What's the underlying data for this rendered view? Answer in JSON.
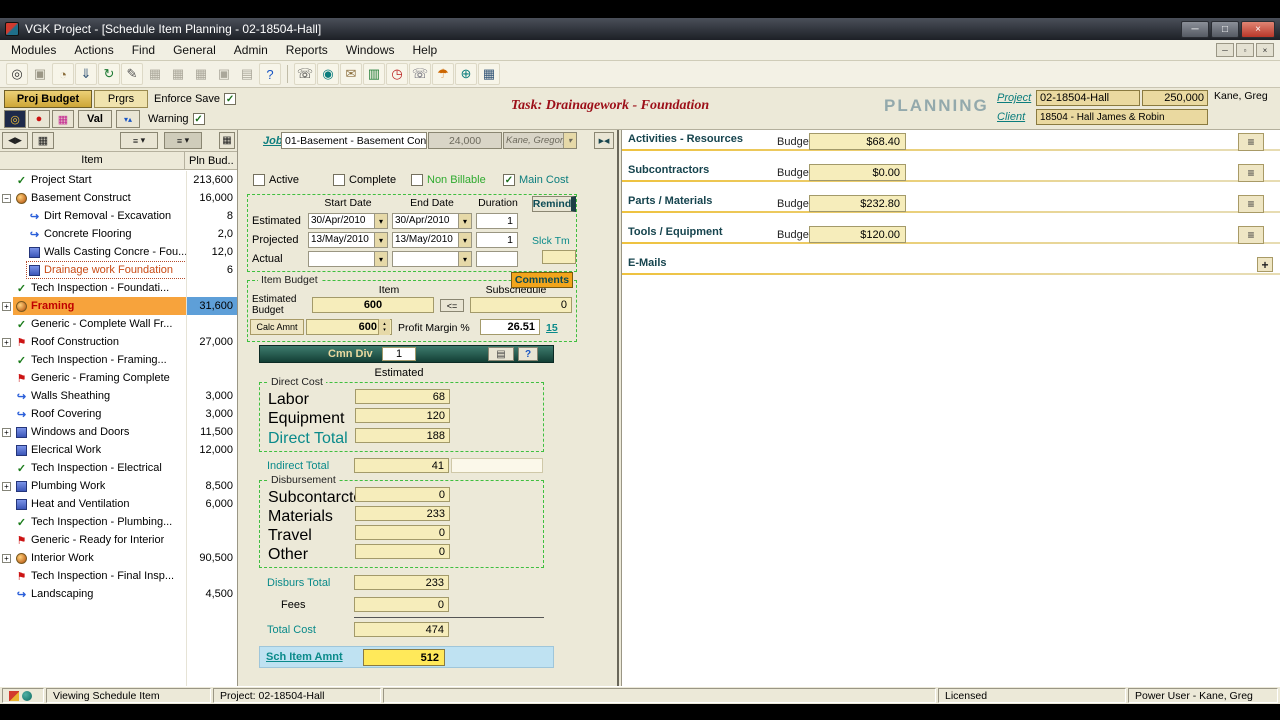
{
  "window": {
    "title": "VGK Project - [Schedule Item Planning - 02-18504-Hall]",
    "menu": [
      "Modules",
      "Actions",
      "Find",
      "General",
      "Admin",
      "Reports",
      "Windows",
      "Help"
    ]
  },
  "icons": {
    "dropdown": "▾",
    "check": "✓",
    "menu_lines": "≡",
    "plus": "+",
    "help": "?",
    "collapse": "▶◀",
    "minimize": "─",
    "maximize": "□",
    "close": "×",
    "mdi_min": "─",
    "mdi_restore": "▫",
    "mdi_close": "×",
    "spin_up": "▴",
    "spin_down": "▾",
    "nav": "◀▶",
    "grid": "▦",
    "printer": "▤",
    "record": "◎",
    "red_dot": "●",
    "magenta_grid": "▦",
    "flags_small": "▾▴"
  },
  "toolbar": {
    "icons": [
      {
        "name": "find-icon",
        "glyph": "◎",
        "color": "#333"
      },
      {
        "name": "save-icon",
        "glyph": "▣",
        "color": "#9a9685",
        "disabled": true
      },
      {
        "name": "schedule-icon",
        "glyph": "◔",
        "color": "#8a6d3b"
      },
      {
        "name": "export-icon",
        "glyph": "⇓",
        "color": "#335577"
      },
      {
        "name": "refresh-icon",
        "glyph": "↻",
        "color": "#1d7a33"
      },
      {
        "name": "edit-icon",
        "glyph": "✎",
        "color": "#555555"
      },
      {
        "name": "media-icon-1",
        "glyph": "▦",
        "color": "#aaa79a",
        "disabled": true
      },
      {
        "name": "media-icon-2",
        "glyph": "▦",
        "color": "#aaa79a",
        "disabled": true
      },
      {
        "name": "media-icon-3",
        "glyph": "▦",
        "color": "#aaa79a",
        "disabled": true
      },
      {
        "name": "copy-icon",
        "glyph": "▣",
        "color": "#aaa79a",
        "disabled": true
      },
      {
        "name": "print-icon",
        "glyph": "▤",
        "color": "#aaa79a",
        "disabled": true
      },
      {
        "name": "help-icon",
        "glyph": "?",
        "color": "#1a56c4"
      },
      {
        "sep": true
      },
      {
        "name": "phone-icon",
        "glyph": "☏",
        "color": "#333333"
      },
      {
        "name": "camera-icon",
        "glyph": "◉",
        "color": "#0b7d7d"
      },
      {
        "name": "mail-icon",
        "glyph": "✉",
        "color": "#8a6d3b"
      },
      {
        "name": "chart-icon",
        "glyph": "▥",
        "color": "#1d7a33"
      },
      {
        "name": "alarm-icon",
        "glyph": "◷",
        "color": "#bb2222"
      },
      {
        "name": "fax-icon",
        "glyph": "☏",
        "color": "#556"
      },
      {
        "name": "vacation-icon",
        "glyph": "☂",
        "color": "#cc6600"
      },
      {
        "name": "globe-icon",
        "glyph": "⊕",
        "color": "#0b7d7d"
      },
      {
        "name": "calendar-icon",
        "glyph": "▦",
        "color": "#335577"
      }
    ]
  },
  "header": {
    "tab_proj_budget": "Proj Budget",
    "tab_prgrs": "Prgrs",
    "enforce_save_label": "Enforce Save",
    "val_label": "Val",
    "warning_label": "Warning",
    "task_title": "Task: Drainagework - Foundation",
    "mode": "PLANNING",
    "project_label": "Project",
    "project_code": "02-18504-Hall",
    "project_budget": "250,000",
    "user_name": "Kane, Greg",
    "client_label": "Client",
    "client_value": "18504 - Hall James & Robin"
  },
  "tree": {
    "col_item": "Item",
    "col_budget": "Pln Bud..",
    "items": [
      {
        "icon": "check",
        "label": "Project Start",
        "value": "213,600",
        "indent": 1
      },
      {
        "icon": "globe",
        "label": "Basement Construct",
        "value": "16,000",
        "indent": 0,
        "expander": "minus"
      },
      {
        "icon": "arrow",
        "label": "Dirt Removal - Excavation",
        "value": "8",
        "indent": 2
      },
      {
        "icon": "arrow",
        "label": "Concrete Flooring",
        "value": "2,0",
        "indent": 2
      },
      {
        "icon": "doc",
        "label": "Walls Casting Concre - Fou...",
        "value": "12,0",
        "indent": 2
      },
      {
        "icon": "doc",
        "label": "Drainage work Foundation",
        "value": "6",
        "indent": 2,
        "state": "active-red"
      },
      {
        "icon": "check",
        "label": "Tech Inspection - Foundati...",
        "value": "",
        "indent": 1
      },
      {
        "icon": "globe",
        "label": "Framing",
        "value": "31,600",
        "indent": 0,
        "expander": "plus",
        "state": "selected"
      },
      {
        "icon": "check",
        "label": "Generic - Complete Wall Fr...",
        "value": "",
        "indent": 1
      },
      {
        "icon": "flag",
        "label": "Roof Construction",
        "value": "27,000",
        "indent": 0,
        "expander": "plus"
      },
      {
        "icon": "check",
        "label": "Tech Inspection - Framing...",
        "value": "",
        "indent": 1
      },
      {
        "icon": "flag",
        "label": "Generic - Framing Complete",
        "value": "",
        "indent": 1
      },
      {
        "icon": "arrow",
        "label": "Walls Sheathing",
        "value": "3,000",
        "indent": 1
      },
      {
        "icon": "arrow",
        "label": "Roof Covering",
        "value": "3,000",
        "indent": 1
      },
      {
        "icon": "doc",
        "label": "Windows and Doors",
        "value": "11,500",
        "indent": 0,
        "expander": "plus"
      },
      {
        "icon": "doc",
        "label": "Elecrical Work",
        "value": "12,000",
        "indent": 1
      },
      {
        "icon": "check",
        "label": "Tech Inspection - Electrical",
        "value": "",
        "indent": 1
      },
      {
        "icon": "doc",
        "label": "Plumbing Work",
        "value": "8,500",
        "indent": 0,
        "expander": "plus"
      },
      {
        "icon": "doc",
        "label": "Heat and Ventilation",
        "value": "6,000",
        "indent": 1
      },
      {
        "icon": "check",
        "label": "Tech Inspection - Plumbing...",
        "value": "",
        "indent": 1
      },
      {
        "icon": "flag",
        "label": "Generic - Ready for Interior",
        "value": "",
        "indent": 1
      },
      {
        "icon": "globe",
        "label": "Interior Work",
        "value": "90,500",
        "indent": 0,
        "expander": "plus"
      },
      {
        "icon": "flag",
        "label": "Tech Inspection - Final Insp...",
        "value": "",
        "indent": 1
      },
      {
        "icon": "arrow",
        "label": "Landscaping",
        "value": "4,500",
        "indent": 1
      }
    ]
  },
  "job": {
    "label": "Job",
    "value": "01-Basement - Basement Con",
    "amount": "24,000",
    "person": "Kane, Gregory"
  },
  "flags": {
    "active": "Active",
    "complete": "Complete",
    "non_billable": "Non Billable",
    "main_cost": "Main Cost"
  },
  "dates": {
    "col_start": "Start Date",
    "col_end": "End Date",
    "col_duration": "Duration",
    "remind_label": "Remind",
    "slack_label": "Slck Tm",
    "rows": [
      {
        "label": "Estimated",
        "start": "30/Apr/2010",
        "end": "30/Apr/2010",
        "duration": "1"
      },
      {
        "label": "Projected",
        "start": "13/May/2010",
        "end": "13/May/2010",
        "duration": "1"
      },
      {
        "label": "Actual",
        "start": "",
        "end": "",
        "duration": ""
      }
    ]
  },
  "budget": {
    "comments_label": "Comments",
    "group_label": "Item Budget",
    "col_item": "Item",
    "col_subschedule": "Subschedule",
    "estimated_budget_label": "Estimated Budget",
    "estimated_budget_item": "600",
    "arrow_label": "<=",
    "estimated_budget_sub": "0",
    "calc_amnt_label": "Calc Amnt",
    "calc_amnt_value": "600",
    "profit_margin_label": "Profit Margin %",
    "profit_margin_value": "26.51",
    "profit_margin_alt": "15"
  },
  "costs": {
    "cmn_div_label": "Cmn Div",
    "cmn_div_value": "1",
    "estimated_header": "Estimated",
    "direct_group": "Direct Cost",
    "labor_label": "Labor",
    "labor": "68",
    "equipment_label": "Equipment",
    "equipment": "120",
    "direct_total_label": "Direct Total",
    "direct_total": "188",
    "indirect_total_label": "Indirect Total",
    "indirect_total": "41",
    "disbursement_group": "Disbursement",
    "subcontractors_label": "Subcontarctors",
    "subcontractors": "0",
    "materials_label": "Materials",
    "materials": "233",
    "travel_label": "Travel",
    "travel": "0",
    "other_label": "Other",
    "other": "0",
    "disburs_total_label": "Disburs Total",
    "disburs_total": "233",
    "fees_label": "Fees",
    "fees": "0",
    "total_cost_label": "Total Cost",
    "total_cost": "474",
    "sch_item_label": "Sch Item Amnt",
    "sch_item": "512"
  },
  "right_panel": {
    "sections": [
      {
        "title": "Activities - Resources",
        "budget_label": "Budget",
        "value": "$68.40"
      },
      {
        "title": "Subcontractors",
        "budget_label": "Budget",
        "value": "$0.00"
      },
      {
        "title": "Parts / Materials",
        "budget_label": "Budget",
        "value": "$232.80"
      },
      {
        "title": "Tools / Equipment",
        "budget_label": "Budget",
        "value": "$120.00"
      }
    ],
    "emails_title": "E-Mails"
  },
  "statusbar": {
    "status": "Viewing Schedule Item",
    "project": "Project: 02-18504-Hall",
    "licensed": "Licensed",
    "user": "Power User - Kane, Greg"
  }
}
